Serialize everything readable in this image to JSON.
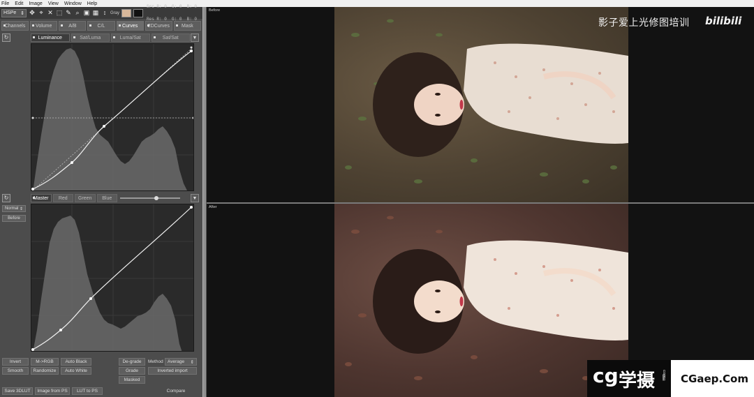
{
  "menu": [
    "File",
    "Edit",
    "Image",
    "View",
    "Window",
    "Help"
  ],
  "toolbar": {
    "mode_select": "HSPe",
    "gray_label": "Gray",
    "readout_lines": [
      "Src R: 0  G: 0  B: 0",
      "Res R: 0  G: 0  B: 0"
    ],
    "fg_color": "#d9b89a",
    "bg_color": "#111111"
  },
  "main_tabs": [
    {
      "label": "Channels",
      "active": false
    },
    {
      "label": "Volume",
      "active": false
    },
    {
      "label": "A/B",
      "active": false
    },
    {
      "label": "C/L",
      "active": false
    },
    {
      "label": "Curves",
      "active": true
    },
    {
      "label": "2DCurves",
      "active": false
    },
    {
      "label": "Mask",
      "active": false
    }
  ],
  "top_subtabs": [
    {
      "label": "Luminance",
      "active": true
    },
    {
      "label": "Sat/Luma",
      "active": false
    },
    {
      "label": "Luma/Sat",
      "active": false
    },
    {
      "label": "Sat/Sat",
      "active": false
    }
  ],
  "bottom_subtabs": [
    {
      "label": "Master",
      "active": true
    },
    {
      "label": "Red",
      "active": false
    },
    {
      "label": "Green",
      "active": false
    },
    {
      "label": "Blue",
      "active": false
    }
  ],
  "side_controls": {
    "mode": "Normal",
    "before": "Before"
  },
  "blend_slider_value": 0.6,
  "bottom_buttons": {
    "invert": "Invert",
    "m_rgb": "M->RGB",
    "auto_black": "Auto Black",
    "smooth": "Smooth",
    "randomize": "Randomize",
    "auto_white": "Auto White",
    "degrade": "De-grade",
    "method_label": "Method",
    "method_value": "Average",
    "grade": "Grade",
    "inverted_import": "Inverted import",
    "masked": "Masked",
    "save_3dlut": "Save 3DLUT",
    "image_from_ps": "Image from PS",
    "lut_to_ps": "LUT to PS",
    "compare": "Compare"
  },
  "views": {
    "before_label": "Before",
    "after_label": "After"
  },
  "watermark": {
    "cn": "影子爱上光修图培训",
    "bili": "bilibili"
  },
  "site_logo": {
    "mark": "cg",
    "cn": "学摄",
    "small": "CG摄影",
    "url": "CGaep.Com"
  }
}
